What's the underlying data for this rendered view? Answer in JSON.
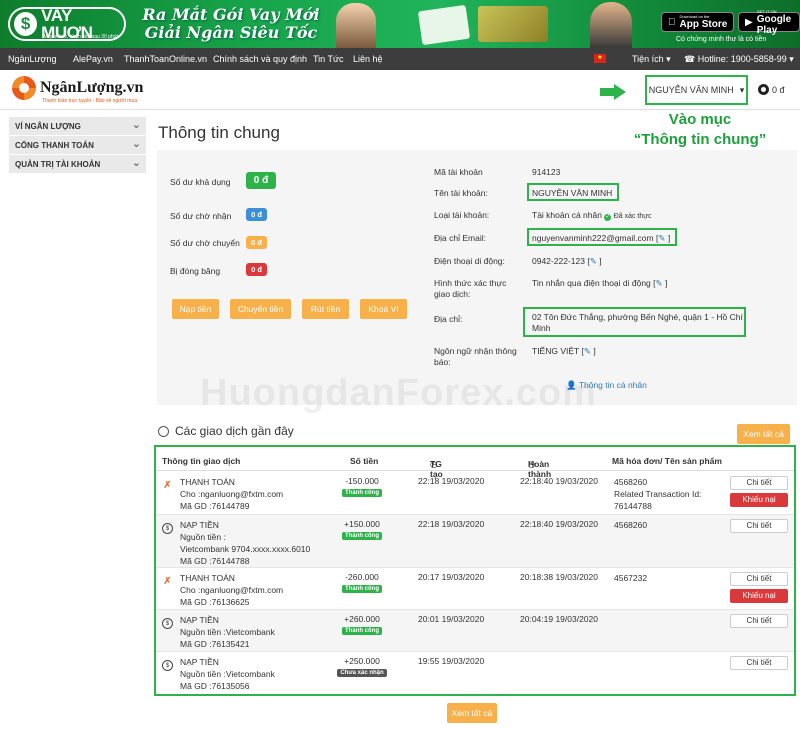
{
  "banner": {
    "brand": "VAY MUỢN",
    "brand_tagline": "Vay online, nhận tiền sau 30 phút",
    "headline_1": "Ra Mắt Gói Vay Mới",
    "headline_2": "Giải Ngân Siêu Tốc",
    "appstore_small": "Download on the",
    "appstore_label": "App Store",
    "googleplay_small": "GET IT ON",
    "googleplay_label": "Google Play",
    "note": "Có chứng minh thư là có tiền"
  },
  "nav": {
    "items": [
      "NgânLượng",
      "AlePay.vn",
      "ThanhToanOnline.vn",
      "Chính sách và quy định",
      "Tin Tức",
      "Liên hệ"
    ],
    "utilities": "Tiện ích ▾",
    "hotline": "Hotline: 1900-5858-99 ▾"
  },
  "header": {
    "logo": "NgânLượng.vn",
    "slogan": "Thanh toán trực tuyến - Bảo vệ người mua",
    "user_name": "NGUYỄN VĂN MINH",
    "balance": "0 đ"
  },
  "sidebar": {
    "items": [
      "VÍ NGÂN LƯỢNG",
      "CỔNG THANH TOÁN",
      "QUẢN TRỊ TÀI KHOẢN"
    ]
  },
  "page": {
    "title": "Thông tin chung",
    "annotation_1": "Vào mục",
    "annotation_2": "“Thông tin chung”",
    "watermark": "HuongdanForex.com"
  },
  "balances": {
    "available_label": "Số dư khả dụng",
    "available_value": "0 đ",
    "pending_in_label": "Số dư chờ nhận",
    "pending_in_value": "0 đ",
    "pending_out_label": "Số dư chờ chuyển",
    "pending_out_value": "0 đ",
    "frozen_label": "Bị đóng băng",
    "frozen_value": "0 đ"
  },
  "actions": {
    "deposit": "Nạp tiền",
    "transfer": "Chuyển tiền",
    "withdraw": "Rút tiền",
    "lock": "Khoá Ví"
  },
  "account": {
    "id_label": "Mã tài khoản",
    "id_value": "914123",
    "name_label": "Tên tài khoản:",
    "name_value": "NGUYỄN VĂN MINH",
    "type_label": "Loại tài khoản:",
    "type_value": "Tài khoản cá nhân",
    "verified": "Đã xác thực",
    "email_label": "Địa chỉ Email:",
    "email_value": "nguyenvanminh222@gmail.com",
    "phone_label": "Điện thoại di động:",
    "phone_value": "0942-222-123",
    "auth_label_1": "Hình thức xác thực",
    "auth_label_2": "giao dịch:",
    "auth_value": "Tin nhắn qua điện thoại di động",
    "address_label": "Địa chỉ:",
    "address_line_1": "02 Tôn Đức Thắng, phường Bến Nghé, quận 1 - Hồ Chí",
    "address_line_2": "Minh",
    "lang_label_1": "Ngôn ngữ nhận thông",
    "lang_label_2": "báo:",
    "lang_value": "TIẾNG VIỆT",
    "personal_link": "Thông tin cá nhân",
    "edit_open": "[",
    "edit_close": "]"
  },
  "transactions": {
    "title": "Các giao dịch gần đây",
    "see_all": "Xem tất cả",
    "headers": [
      "Thông tin giao dịch",
      "Số tiền",
      "TG tạo",
      "Hoàn thành",
      "Mã hóa đơn/ Tên sản phẩm"
    ],
    "detail_label": "Chi tiết",
    "complain_label": "Khiếu nại",
    "rows": [
      {
        "type": "THANH TOÁN",
        "line2": "Cho :nganluong@fxtm.com",
        "line3": "Mã GD :76144789",
        "amount": "-150.000",
        "status": "Thành công",
        "created": "22:18 19/03/2020",
        "completed": "22:18:40 19/03/2020",
        "code1": "4568260",
        "code2": "Related Transaction Id:",
        "code3": "76144788"
      },
      {
        "type": "NẠP TIỀN",
        "line2": "Nguồn tiền :",
        "line3": "Vietcombank 9704.xxxx.xxxx.6010",
        "line4": "Mã GD :76144788",
        "amount": "+150.000",
        "status": "Thành công",
        "created": "22:18 19/03/2020",
        "completed": "22:18:40 19/03/2020",
        "code1": "4568260"
      },
      {
        "type": "THANH TOÁN",
        "line2": "Cho :nganluong@fxtm.com",
        "line3": "Mã GD :76136625",
        "amount": "-260.000",
        "status": "Thành công",
        "created": "20:17 19/03/2020",
        "completed": "20:18:38 19/03/2020",
        "code1": "4567232"
      },
      {
        "type": "NẠP TIỀN",
        "line2": "Nguồn tiền :Vietcombank",
        "line3": "Mã GD :76135421",
        "amount": "+260.000",
        "status": "Thành công",
        "created": "20:01 19/03/2020",
        "completed": "20:04:19 19/03/2020"
      },
      {
        "type": "NẠP TIỀN",
        "line2": "Nguồn tiền :Vietcombank",
        "line3": "Mã GD :76135056",
        "amount": "+250.000",
        "status": "Chưa xác nhận",
        "created": "19:55 19/03/2020",
        "completed": ""
      }
    ]
  },
  "colors": {
    "green": "#2db34a",
    "orange": "#f7b04a",
    "blue": "#3d8fd6",
    "red": "#d9393a"
  }
}
